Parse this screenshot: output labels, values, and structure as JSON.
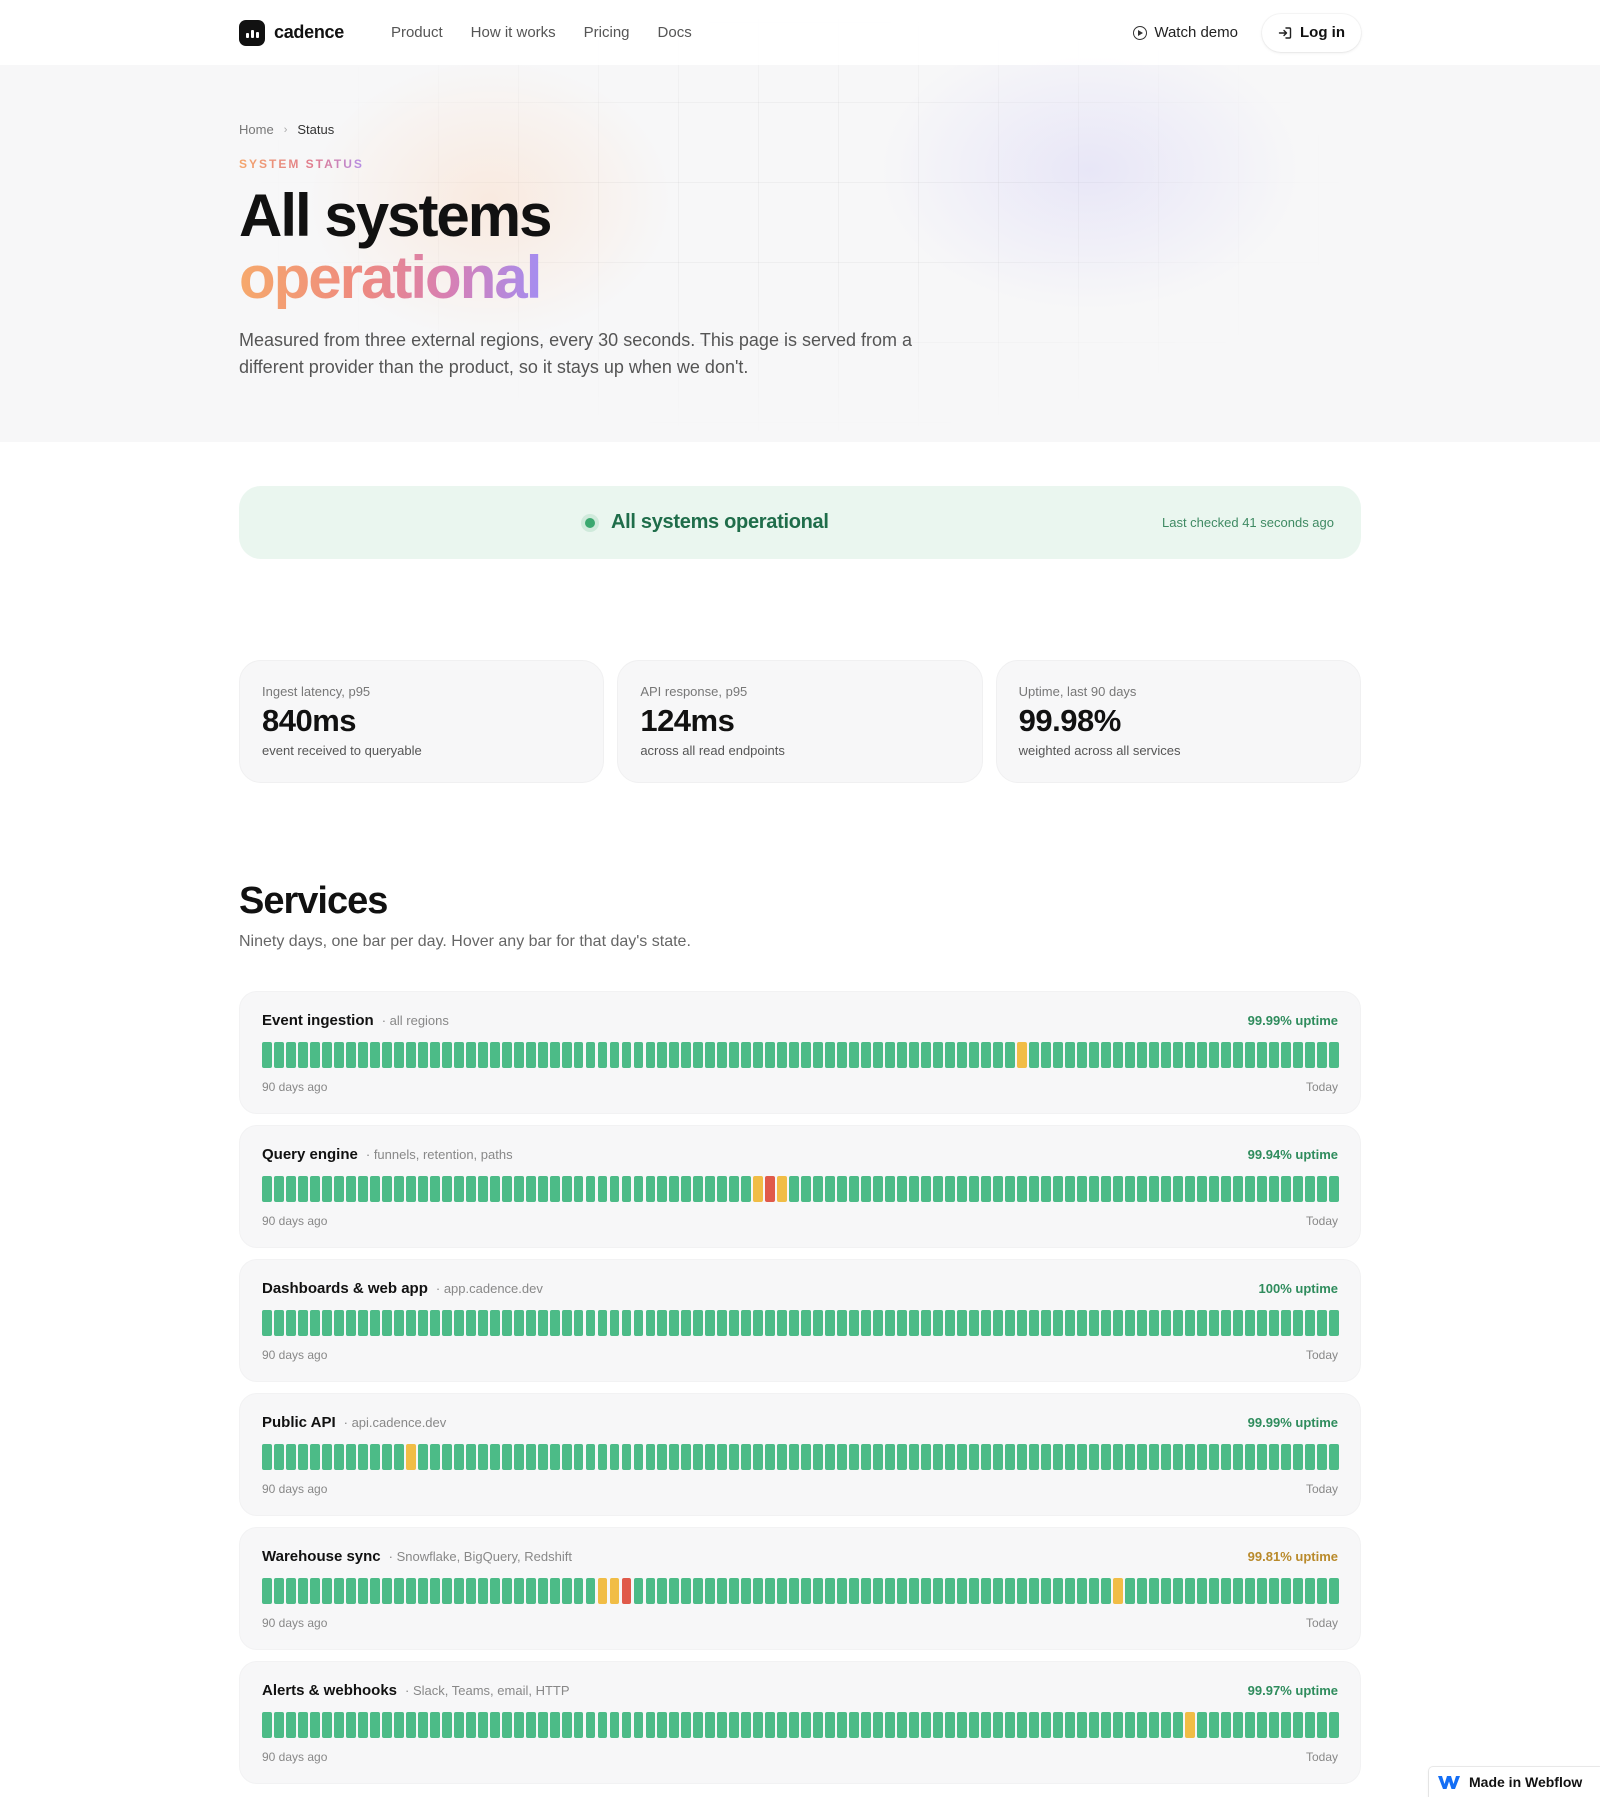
{
  "brand": {
    "name": "cadence"
  },
  "nav": {
    "links": [
      "Product",
      "How it works",
      "Pricing",
      "Docs"
    ],
    "watch_demo": "Watch demo",
    "login": "Log in"
  },
  "breadcrumb": {
    "home": "Home",
    "current": "Status"
  },
  "hero": {
    "eyebrow": "SYSTEM STATUS",
    "title_line1": "All systems",
    "title_line2": "operational",
    "lede": "Measured from three external regions, every 30 seconds. This page is served from a different provider than the product, so it stays up when we don't."
  },
  "banner": {
    "status": "All systems operational",
    "last_checked": "Last checked 41 seconds ago"
  },
  "metrics": [
    {
      "label": "Ingest latency, p95",
      "value": "840ms",
      "sub": "event received to queryable"
    },
    {
      "label": "API response, p95",
      "value": "124ms",
      "sub": "across all read endpoints"
    },
    {
      "label": "Uptime, last 90 days",
      "value": "99.98%",
      "sub": "weighted across all services"
    }
  ],
  "services_section": {
    "title": "Services",
    "subtitle": "Ninety days, one bar per day. Hover any bar for that day's state."
  },
  "services": [
    {
      "name": "Event ingestion",
      "meta": "all regions",
      "uptime": "99.99% uptime",
      "uptime_status": "ok",
      "start": "90 days ago",
      "end": "Today",
      "degraded_days": [
        63
      ],
      "outage_days": []
    },
    {
      "name": "Query engine",
      "meta": "funnels, retention, paths",
      "uptime": "99.94% uptime",
      "uptime_status": "ok",
      "start": "90 days ago",
      "end": "Today",
      "degraded_days": [
        41,
        43
      ],
      "outage_days": [
        42
      ]
    },
    {
      "name": "Dashboards & web app",
      "meta": "app.cadence.dev",
      "uptime": "100% uptime",
      "uptime_status": "ok",
      "start": "90 days ago",
      "end": "Today",
      "degraded_days": [],
      "outage_days": []
    },
    {
      "name": "Public API",
      "meta": "api.cadence.dev",
      "uptime": "99.99% uptime",
      "uptime_status": "ok",
      "start": "90 days ago",
      "end": "Today",
      "degraded_days": [
        12
      ],
      "outage_days": []
    },
    {
      "name": "Warehouse sync",
      "meta": "Snowflake, BigQuery, Redshift",
      "uptime": "99.81% uptime",
      "uptime_status": "warn",
      "start": "90 days ago",
      "end": "Today",
      "degraded_days": [
        28,
        29,
        71
      ],
      "outage_days": [
        30
      ]
    },
    {
      "name": "Alerts & webhooks",
      "meta": "Slack, Teams, email, HTTP",
      "uptime": "99.97% uptime",
      "uptime_status": "ok",
      "start": "90 days ago",
      "end": "Today",
      "degraded_days": [
        77
      ],
      "outage_days": []
    }
  ],
  "days_per_service": 90,
  "colors": {
    "operational": "#4cbb87",
    "degraded": "#f1bd46",
    "outage": "#e05a4a",
    "banner_bg": "#eaf6ef"
  },
  "webflow_badge": "Made in Webflow"
}
